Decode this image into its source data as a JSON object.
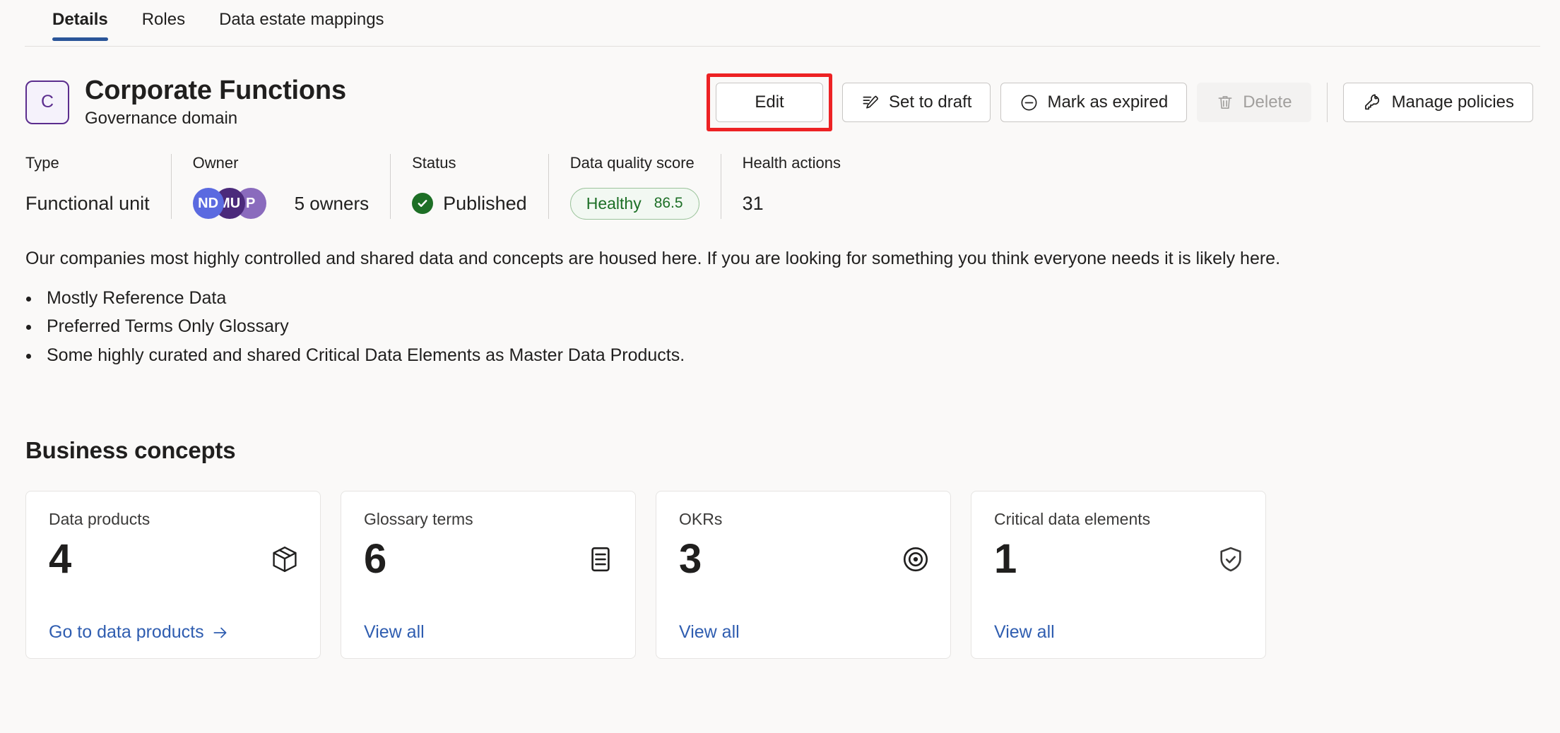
{
  "tabs": [
    {
      "label": "Details",
      "active": true
    },
    {
      "label": "Roles",
      "active": false
    },
    {
      "label": "Data estate mappings",
      "active": false
    }
  ],
  "header": {
    "avatar_letter": "C",
    "title": "Corporate Functions",
    "subtitle": "Governance domain"
  },
  "actions": {
    "edit": "Edit",
    "set_to_draft": "Set to draft",
    "mark_as_expired": "Mark as expired",
    "delete": "Delete",
    "manage_policies": "Manage policies",
    "highlight_color": "#ed2224"
  },
  "meta": {
    "type": {
      "label": "Type",
      "value": "Functional unit"
    },
    "owner": {
      "label": "Owner",
      "avatars": [
        {
          "initials": "ND",
          "color": "#5b6ae0"
        },
        {
          "initials": "MU",
          "color": "#4b2a7b"
        },
        {
          "initials": "P",
          "color": "#8a6bbd"
        }
      ],
      "count": "5 owners"
    },
    "status": {
      "label": "Status",
      "value": "Published",
      "color": "#1d6f26"
    },
    "data_quality": {
      "label": "Data quality score",
      "state": "Healthy",
      "score": "86.5",
      "color": "#1d6f26"
    },
    "health_actions": {
      "label": "Health actions",
      "value": "31"
    }
  },
  "description": {
    "paragraph": "Our companies most highly controlled and shared data and concepts are housed here. If you are looking for something you think everyone needs it is likely here.",
    "bullets": [
      "Mostly Reference Data",
      "Preferred Terms Only Glossary",
      "Some highly curated and shared Critical Data Elements as Master Data Products."
    ]
  },
  "business_concepts": {
    "section_title": "Business concepts",
    "cards": [
      {
        "title": "Data products",
        "count": "4",
        "link": "Go to data products",
        "icon": "box-icon",
        "has_arrow": true
      },
      {
        "title": "Glossary terms",
        "count": "6",
        "link": "View all",
        "icon": "document-list-icon",
        "has_arrow": false
      },
      {
        "title": "OKRs",
        "count": "3",
        "link": "View all",
        "icon": "target-icon",
        "has_arrow": false
      },
      {
        "title": "Critical data elements",
        "count": "1",
        "link": "View all",
        "icon": "shield-check-icon",
        "has_arrow": false
      }
    ]
  }
}
